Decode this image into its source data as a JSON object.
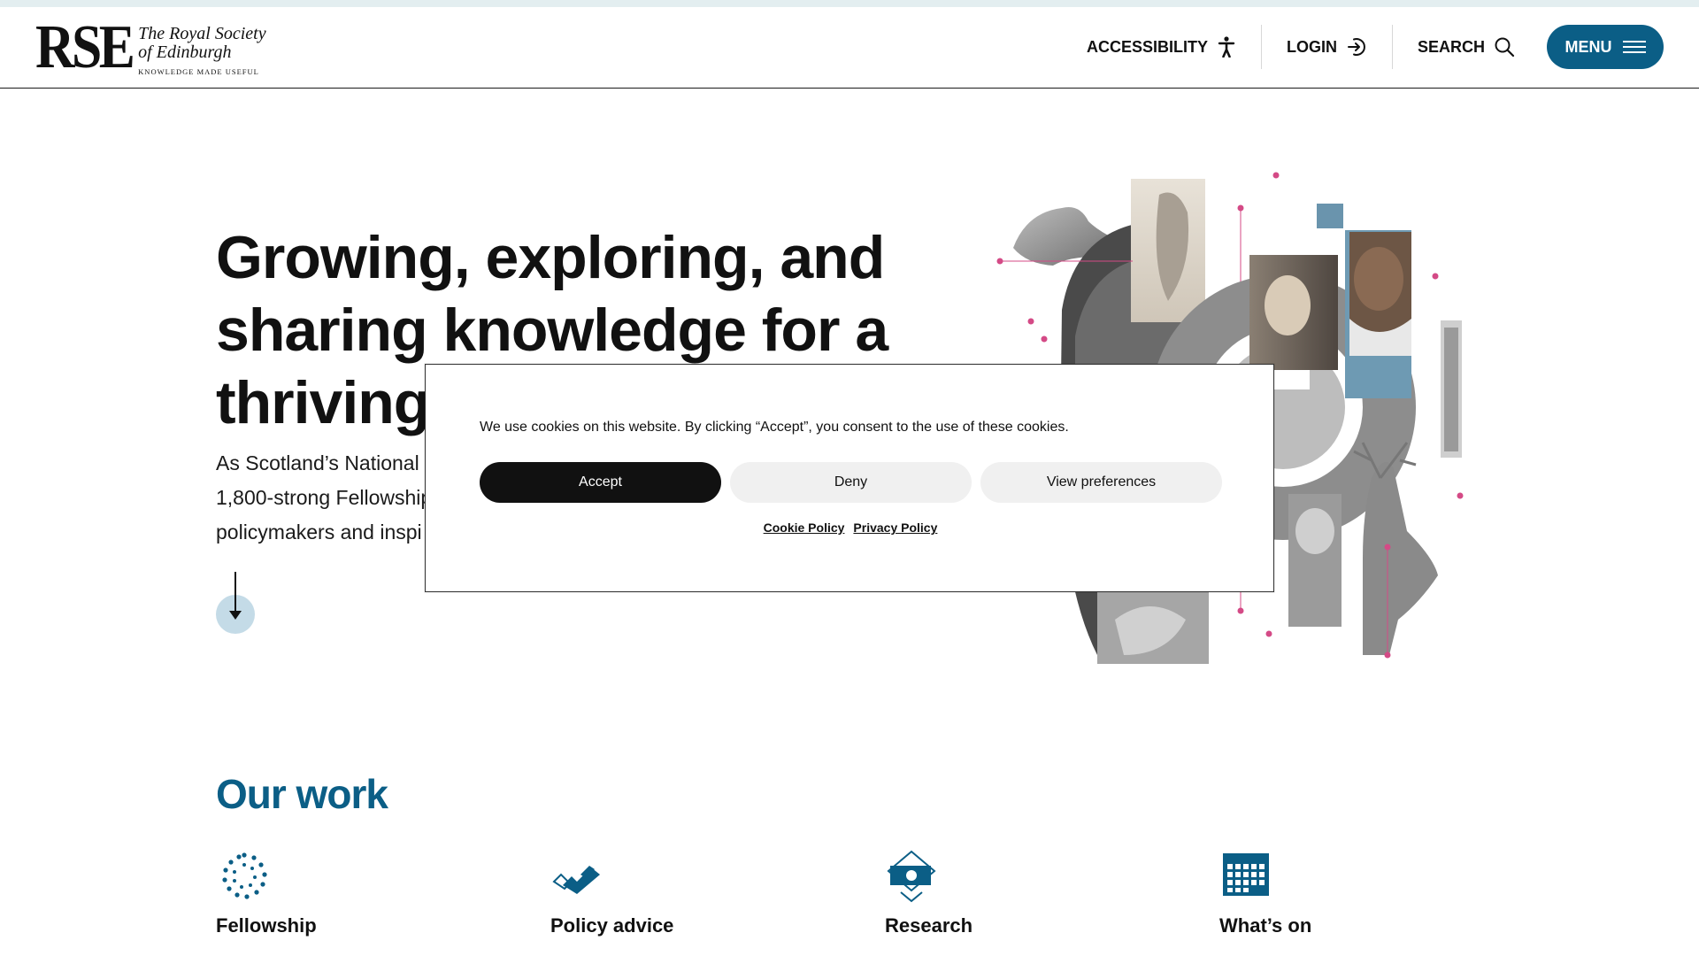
{
  "header": {
    "logo": {
      "mark": "RSE",
      "name_line1": "The Royal Society",
      "name_line2": "of Edinburgh",
      "tagline": "KNOWLEDGE MADE USEFUL"
    },
    "accessibility_label": "ACCESSIBILITY",
    "login_label": "LOGIN",
    "search_label": "SEARCH",
    "menu_label": "MENU"
  },
  "hero": {
    "title_line1": "Growing, exploring, and",
    "title_line2": "sharing knowledge for a",
    "title_line3": "thriving",
    "desc_line1": "As Scotland’s National",
    "desc_line2": "1,800-strong Fellowship",
    "desc_line3": "policymakers and inspi"
  },
  "our_work": {
    "title": "Our work",
    "items": [
      {
        "label": "Fellowship",
        "icon": "spiral-icon"
      },
      {
        "label": "Policy advice",
        "icon": "checkmark-icon"
      },
      {
        "label": "Research",
        "icon": "research-icon"
      },
      {
        "label": "What’s on",
        "icon": "calendar-icon"
      }
    ]
  },
  "cookie": {
    "message": "We use cookies on this website. By clicking “Accept”, you consent to the use of these cookies.",
    "accept_label": "Accept",
    "deny_label": "Deny",
    "preferences_label": "View preferences",
    "cookie_policy_label": "Cookie Policy",
    "privacy_policy_label": "Privacy Policy"
  },
  "colors": {
    "brand_blue": "#0b5e86",
    "accent_pink": "#d44a86",
    "scroll_circle": "#c4dbe7"
  }
}
